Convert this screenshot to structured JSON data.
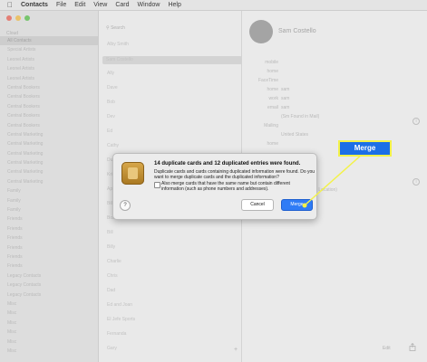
{
  "menubar": {
    "apple_icon": "apple-logo",
    "app_name": "Contacts",
    "items": [
      "File",
      "Edit",
      "View",
      "Card",
      "Window",
      "Help"
    ]
  },
  "sidebar": {
    "header": "Cloud",
    "items": [
      "All Contacts",
      "Special Artists",
      "Leonel Artists",
      "Leonel Artists",
      "Leonel Artists",
      "Central Bookers",
      "Central Bookers",
      "Central Bookers",
      "Central Bookers",
      "Central Bookers",
      "Central Marketing",
      "Central Marketing",
      "Central Marketing",
      "Central Marketing",
      "Central Marketing",
      "Central Marketing",
      "Family",
      "Family",
      "Family",
      "Friends",
      "Friends",
      "Friends",
      "Friends",
      "Friends",
      "Friends",
      "Legacy Contacts",
      "Legacy Contacts",
      "Legacy Contacts",
      "Misc",
      "Misc",
      "Misc",
      "Misc",
      "Misc",
      "Misc"
    ]
  },
  "contact_list": {
    "search_placeholder": "Search",
    "items": [
      "Alby Smith",
      "Sam Costello",
      "Ally",
      "Dave",
      "Bob",
      "Dev",
      "Ed",
      "Cathy",
      "Dustin",
      "Kristin",
      "Apple Inc.",
      "Bill",
      "Bob",
      "Bill",
      "Billy",
      "Charlie",
      "Chris",
      "Dad",
      "Ed and Joan",
      "El Jefe Sports",
      "Fernanda",
      "Gary"
    ]
  },
  "detail": {
    "name": "Sam Costello",
    "fields": [
      {
        "label": "mobile",
        "value": ""
      },
      {
        "label": "home",
        "value": ""
      },
      {
        "label": "FaceTime",
        "value": ""
      },
      {
        "label": "home",
        "value": "sam"
      },
      {
        "label": "work",
        "value": "sam"
      },
      {
        "label": "email",
        "value": "sam"
      },
      {
        "label": "",
        "value": "(Sm Found in Mail)"
      },
      {
        "label": "Mailing",
        "value": ""
      },
      {
        "label": "",
        "value": "United States"
      },
      {
        "label": "home",
        "value": ""
      }
    ],
    "extra": "(Not Associated Location)",
    "edit_label": "Edit"
  },
  "dialog": {
    "title": "14 duplicate cards and 12 duplicated entries were found.",
    "body": "Duplicate cards and cards containing duplicated information were found. Do you want to merge duplicate cards and the duplicated information?",
    "checkbox_label": "Also merge cards that have the same name but contain different information (such as phone numbers and addresses).",
    "help_label": "?",
    "cancel_label": "Cancel",
    "merge_label": "Merge"
  },
  "callout": {
    "label": "Merge",
    "color": "#1c6fe6",
    "border": "#f3f24a"
  }
}
